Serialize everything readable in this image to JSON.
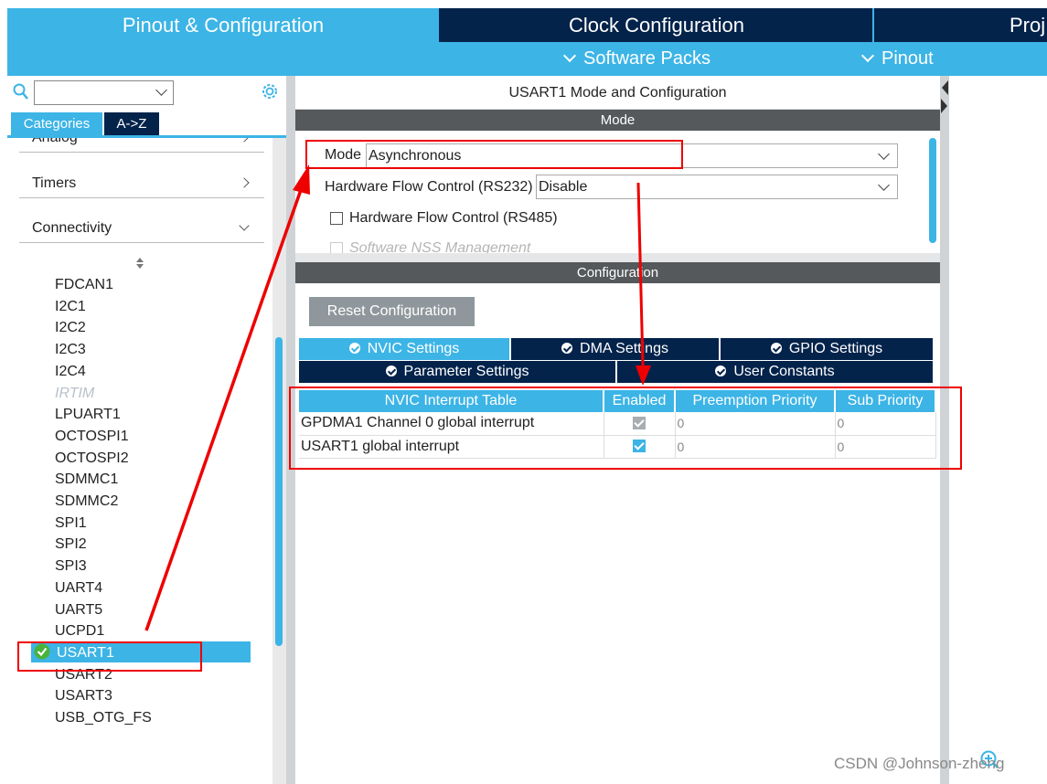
{
  "top_tabs": [
    "Pinout & Configuration",
    "Clock Configuration",
    "Proj"
  ],
  "sub_menu": [
    "Software Packs",
    "Pinout"
  ],
  "left": {
    "category_tabs": [
      "Categories",
      "A->Z"
    ],
    "groups": [
      "Analog",
      "Timers",
      "Connectivity"
    ],
    "peripherals": [
      "FDCAN1",
      "I2C1",
      "I2C2",
      "I2C3",
      "I2C4",
      "IRTIM",
      "LPUART1",
      "OCTOSPI1",
      "OCTOSPI2",
      "SDMMC1",
      "SDMMC2",
      "SPI1",
      "SPI2",
      "SPI3",
      "UART4",
      "UART5",
      "UCPD1",
      "USART1",
      "USART2",
      "USART3",
      "USB_OTG_FS"
    ],
    "disabled_peripheral": "IRTIM",
    "selected_peripheral": "USART1"
  },
  "panel": {
    "title": "USART1 Mode and Configuration",
    "mode_header": "Mode",
    "mode_label": "Mode",
    "mode_value": "Asynchronous",
    "hfc_rs232_label": "Hardware Flow Control (RS232)",
    "hfc_rs232_value": "Disable",
    "hfc_rs485_label": "Hardware Flow Control (RS485)",
    "nss_label": "Software NSS Management",
    "config_header": "Configuration",
    "reset_button": "Reset Configuration",
    "tabs_row1": [
      "NVIC Settings",
      "DMA Settings",
      "GPIO Settings"
    ],
    "tabs_row2": [
      "Parameter Settings",
      "User Constants"
    ],
    "active_tab": "NVIC Settings"
  },
  "nvic": {
    "headers": [
      "NVIC Interrupt Table",
      "Enabled",
      "Preemption Priority",
      "Sub Priority"
    ],
    "rows": [
      {
        "name": "GPDMA1 Channel 0 global interrupt",
        "enabled": true,
        "locked": true,
        "preemption": "0",
        "sub": "0"
      },
      {
        "name": "USART1 global interrupt",
        "enabled": true,
        "locked": false,
        "preemption": "0",
        "sub": "0"
      }
    ]
  },
  "watermark": "CSDN @Johnson-zheng",
  "colors": {
    "accent": "#3cb4e6",
    "navy": "#03234b",
    "section": "#55595c",
    "annotation": "#ee0000"
  }
}
